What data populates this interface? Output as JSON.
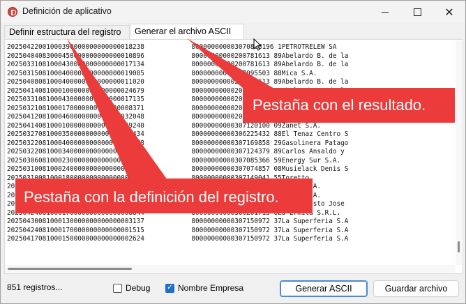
{
  "window": {
    "title": "Definición de aplicativo",
    "close_glyph": "✕"
  },
  "tabs": [
    {
      "label": "Definir estructura del registro",
      "selected": false
    },
    {
      "label": "Generar el archivo ASCII",
      "selected": true
    }
  ],
  "output_lines": [
    "20250422001000390000000000000018238            800000000003070808196 1PETROTRELEW SA",
    "20250404083000450000000000000010896            80000000000200781613 89Abelardo B. de la",
    "20250331081000430000000000000017134            80000000000200781613 89Abelardo B. de la",
    "20250315081000400000000000000019085            80000000000307095503 88Mica S.A.",
    "20250408081000400000000000000011020            80000000000200781613 89Abelardo B. de la",
    "20250414081000100000000000000024679            80000000000200781613 89Abelardo B. de la",
    "20250331081000430000000000000017135            80000000000200781613 89Abelardo B. de la",
    "20250321081000170000000000000008371            80000000000200781613 89Abelardo B. de la",
    "20250412081000460000000000000032048            80000000000200781613 89Abelardo B. de la",
    "20250414081000100000000000000029240            80000000000307120100 09Zanet S.A.",
    "20250327081000350000000000000043434            80000000000306225432 88El Tenaz Centro S",
    "20250322081000400000000000000017778            80000000000307169858 29Gasolinera Patago",
    "20250322081000340000000000000007869            80000000000307124379 89Carlos Ansaldo y",
    "20250306081000230000000000000001028            80000000000307085366 59Energy Sur S.A.",
    "20250310081000240000000000000007456            80000000000307074857 08Musielack Denis S",
    "20250310081000180000000000000008890            80000000000307149041 55Toretto",
    "20250319081000150000000000000009000            80000000000307120100 09Zanet S.A.",
    "20250321081000110000000000000007777            80000000000307120100 09Zanet S.A.",
    "20250401081000060000000000000001330            80000000000200835411 1Lana Ernesto Jose",
    "20250424081000170000000000000008844            80000000000306201715 6La Ermita S.R.L.",
    "20250430081000130000000000000003137            80000000000307150972 37La Superferia S.A",
    "20250424081000170000000000000001515            80000000000307150972 37La Superferia S.A",
    "20250417081000150000000000000002624            80000000000307150972 37La Superferia S.A"
  ],
  "status": {
    "record_count": "851 registros..."
  },
  "options": {
    "debug": {
      "label": "Debug",
      "checked": false
    },
    "nombre_empresa": {
      "label": "Nombre Empresa",
      "checked": true,
      "check_glyph": "✓"
    }
  },
  "buttons": {
    "generate": "Generar ASCII",
    "save": "Guardar archivo"
  },
  "callouts": {
    "result": "Pestaña con el resultado.",
    "definition": "Pestaña con la definición del registro.",
    "color": "#ec3b3b"
  }
}
